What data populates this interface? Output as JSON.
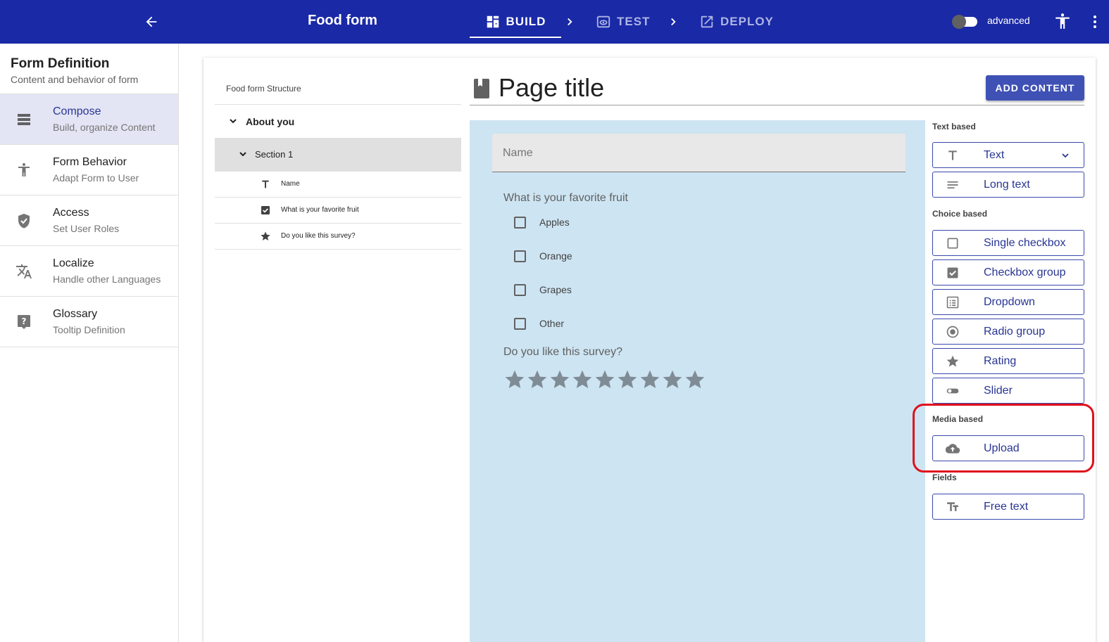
{
  "topbar": {
    "title": "Food form",
    "steps": [
      {
        "label": "BUILD",
        "icon": "dashboard-icon",
        "active": true
      },
      {
        "label": "TEST",
        "icon": "preview-icon",
        "active": false
      },
      {
        "label": "DEPLOY",
        "icon": "open-in-new-icon",
        "active": false
      }
    ],
    "toggle_label": "advanced"
  },
  "sidebar": {
    "title": "Form Definition",
    "subtitle": "Content and behavior of form",
    "items": [
      {
        "label": "Compose",
        "sub": "Build, organize Content",
        "icon": "view-list-icon",
        "selected": true
      },
      {
        "label": "Form Behavior",
        "sub": "Adapt Form to User",
        "icon": "accessibility-icon"
      },
      {
        "label": "Access",
        "sub": "Set User Roles",
        "icon": "shield-icon"
      },
      {
        "label": "Localize",
        "sub": "Handle other Languages",
        "icon": "translate-icon"
      },
      {
        "label": "Glossary",
        "sub": "Tooltip Definition",
        "icon": "help-icon"
      }
    ]
  },
  "structure": {
    "header": "Food form Structure",
    "page": "About you",
    "section": "Section 1",
    "fields": [
      {
        "label": "Name",
        "icon": "text-icon"
      },
      {
        "label": "What is your favorite fruit",
        "icon": "checkbox-icon"
      },
      {
        "label": "Do you like this survey?",
        "icon": "star-icon"
      }
    ]
  },
  "page": {
    "title": "Page title",
    "add_content": "ADD CONTENT"
  },
  "preview": {
    "name_placeholder": "Name",
    "fruit_question": "What is your favorite fruit",
    "fruit_options": [
      "Apples",
      "Orange",
      "Grapes",
      "Other"
    ],
    "survey_question": "Do you like this survey?",
    "rating_max": 9
  },
  "palette": {
    "text_based": "Text based",
    "text": "Text",
    "long_text": "Long text",
    "choice_based": "Choice based",
    "single_checkbox": "Single checkbox",
    "checkbox_group": "Checkbox group",
    "dropdown": "Dropdown",
    "radio_group": "Radio group",
    "rating": "Rating",
    "slider": "Slider",
    "media_based": "Media based",
    "upload": "Upload",
    "fields": "Fields",
    "free_text": "Free text"
  },
  "colors": {
    "topbar": "#1a29a6",
    "primary": "#3f51b5",
    "preview_bg": "#cde4f2",
    "highlight": "#e0101c"
  }
}
